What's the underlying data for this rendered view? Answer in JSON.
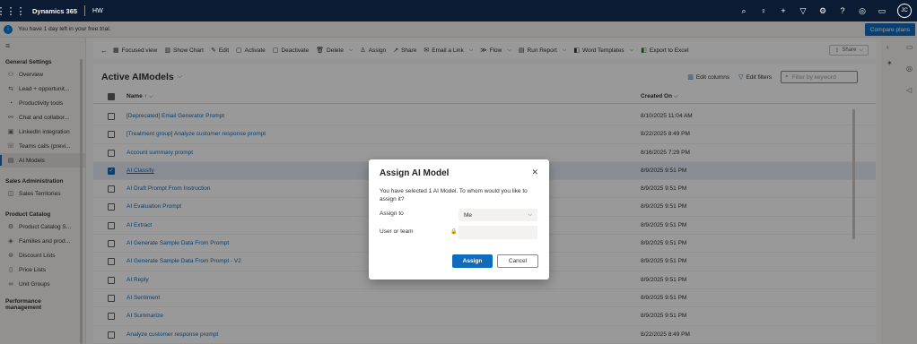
{
  "topbar": {
    "app_name": "Dynamics 365",
    "env_name": "HW",
    "avatar_initials": "JC",
    "icons": [
      "search-icon",
      "lightbulb-icon",
      "plus-icon",
      "filter-icon",
      "gear-icon",
      "help-icon",
      "copilot-icon",
      "chat-icon"
    ]
  },
  "trial": {
    "message": "You have 1 day left in your free trial.",
    "compare_label": "Compare plans"
  },
  "sidebar": {
    "groups": [
      {
        "title": "General Settings",
        "items": [
          {
            "label": "Overview",
            "icon": "overview-icon"
          },
          {
            "label": "Lead + opportunit...",
            "icon": "lead-icon"
          },
          {
            "label": "Productivity tools",
            "icon": "productivity-icon"
          },
          {
            "label": "Chat and collabor...",
            "icon": "chat-icon"
          },
          {
            "label": "LinkedIn integration",
            "icon": "linkedin-icon"
          },
          {
            "label": "Teams calls (previ...",
            "icon": "teams-icon"
          },
          {
            "label": "AI Models",
            "icon": "ai-models-icon"
          }
        ]
      },
      {
        "title": "Sales Administration",
        "items": [
          {
            "label": "Sales Territories",
            "icon": "territories-icon"
          }
        ]
      },
      {
        "title": "Product Catalog",
        "items": [
          {
            "label": "Product Catalog S...",
            "icon": "catalog-icon"
          },
          {
            "label": "Families and prod...",
            "icon": "families-icon"
          },
          {
            "label": "Discount Lists",
            "icon": "discount-icon"
          },
          {
            "label": "Price Lists",
            "icon": "price-icon"
          },
          {
            "label": "Unit Groups",
            "icon": "unit-icon"
          }
        ]
      },
      {
        "title": "Performance management",
        "items": []
      }
    ]
  },
  "commandbar": {
    "items": [
      {
        "label": "Focused view"
      },
      {
        "label": "Show Chart"
      },
      {
        "label": "Edit"
      },
      {
        "label": "Activate"
      },
      {
        "label": "Deactivate"
      },
      {
        "label": "Delete"
      },
      {
        "label": "Assign"
      },
      {
        "label": "Share"
      },
      {
        "label": "Email a Link"
      },
      {
        "label": "Flow"
      },
      {
        "label": "Run Report"
      },
      {
        "label": "Word Templates"
      },
      {
        "label": "Export to Excel"
      }
    ],
    "share_label": "Share"
  },
  "grid": {
    "view_title": "Active AIModels",
    "edit_columns": "Edit columns",
    "edit_filters": "Edit filters",
    "filter_placeholder": "Filter by keyword",
    "col_name": "Name ↑",
    "col_created": "Created On",
    "rows": [
      {
        "name": "[Deprecated] Email Generator Prompt",
        "created": "8/10/2025 11:04 AM",
        "selected": false
      },
      {
        "name": "[Treatment group] Analyze customer response prompt",
        "created": "8/22/2025 8:49 PM",
        "selected": false
      },
      {
        "name": "Account summary prompt",
        "created": "8/16/2025 7:29 PM",
        "selected": false
      },
      {
        "name": "AI Classify",
        "created": "8/9/2025 9:51 PM",
        "selected": true
      },
      {
        "name": "AI Draft Prompt From Instruction",
        "created": "8/9/2025 9:51 PM",
        "selected": false
      },
      {
        "name": "AI Evaluation Prompt",
        "created": "8/9/2025 9:51 PM",
        "selected": false
      },
      {
        "name": "AI Extract",
        "created": "8/9/2025 9:51 PM",
        "selected": false
      },
      {
        "name": "AI Generate Sample Data From Prompt",
        "created": "8/9/2025 9:51 PM",
        "selected": false
      },
      {
        "name": "AI Generate Sample Data From Prompt - V2",
        "created": "8/9/2025 9:51 PM",
        "selected": false
      },
      {
        "name": "AI Reply",
        "created": "8/9/2025 9:51 PM",
        "selected": false
      },
      {
        "name": "AI Sentiment",
        "created": "8/9/2025 9:51 PM",
        "selected": false
      },
      {
        "name": "AI Summarize",
        "created": "8/9/2025 9:51 PM",
        "selected": false
      },
      {
        "name": "Analyze customer response prompt",
        "created": "8/22/2025 8:49 PM",
        "selected": false
      }
    ]
  },
  "dialog": {
    "title": "Assign AI Model",
    "message": "You have selected 1 AI Model. To whom would you like to assign it?",
    "assign_to_label": "Assign to",
    "assign_to_value": "Me",
    "user_team_label": "User or team",
    "assign_button": "Assign",
    "cancel_button": "Cancel"
  }
}
